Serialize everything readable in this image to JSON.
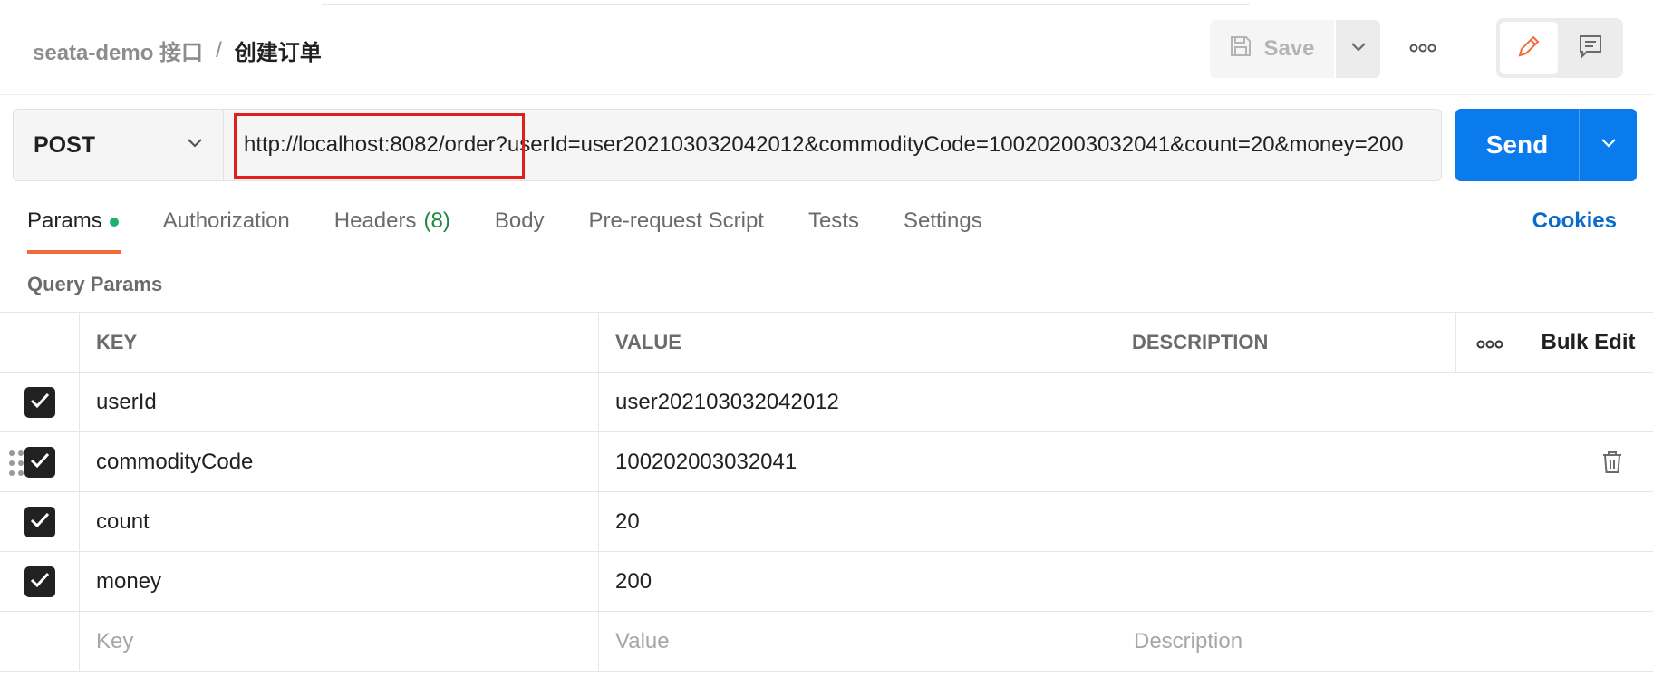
{
  "breadcrumb": {
    "collection": "seata-demo 接口",
    "separator": "/",
    "request": "创建订单"
  },
  "toolbar": {
    "save_label": "Save",
    "more_icon": "more-horizontal-icon",
    "edit_icon": "pencil-icon",
    "comment_icon": "comment-icon"
  },
  "request": {
    "method": "POST",
    "url": "http://localhost:8082/order?userId=user202103032042012&commodityCode=100202003032041&count=20&money=200",
    "send_label": "Send"
  },
  "tabs": [
    {
      "label": "Params",
      "active": true,
      "indicator": "green-dot"
    },
    {
      "label": "Authorization"
    },
    {
      "label": "Headers",
      "count": "(8)"
    },
    {
      "label": "Body"
    },
    {
      "label": "Pre-request Script"
    },
    {
      "label": "Tests"
    },
    {
      "label": "Settings"
    }
  ],
  "cookies_label": "Cookies",
  "query_params": {
    "title": "Query Params",
    "headers": {
      "key": "KEY",
      "value": "VALUE",
      "description": "DESCRIPTION",
      "bulk_edit": "Bulk Edit"
    },
    "rows": [
      {
        "checked": true,
        "key": "userId",
        "value": "user202103032042012",
        "description": ""
      },
      {
        "checked": true,
        "key": "commodityCode",
        "value": "100202003032041",
        "description": ""
      },
      {
        "checked": true,
        "key": "count",
        "value": "20",
        "description": ""
      },
      {
        "checked": true,
        "key": "money",
        "value": "200",
        "description": ""
      }
    ],
    "placeholders": {
      "key": "Key",
      "value": "Value",
      "description": "Description"
    }
  },
  "colors": {
    "accent": "#097bed",
    "active_tab_underline": "#f26b3a",
    "highlight_box": "#e02020",
    "cookies": "#0a6bcc",
    "headers_count": "#1a8a3c"
  }
}
